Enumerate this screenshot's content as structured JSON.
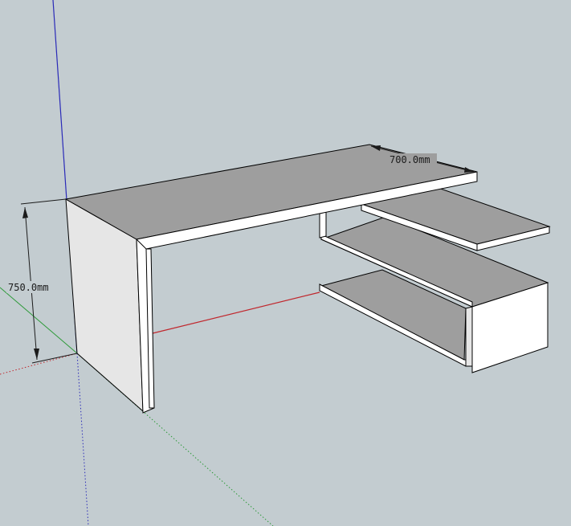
{
  "dimensions": {
    "depth": "700.0mm",
    "height": "750.0mm"
  },
  "colors": {
    "background": "#c3ccd0",
    "face_top": "#9e9e9e",
    "face_side": "#e6e6e6",
    "face_front": "#ffffff",
    "edge": "#000000",
    "axis_red": "#c0272d",
    "axis_green": "#2e9a3a",
    "axis_blue": "#2a2ab8"
  },
  "icons": {
    "dimension_arrow": "arrowhead-icon"
  }
}
